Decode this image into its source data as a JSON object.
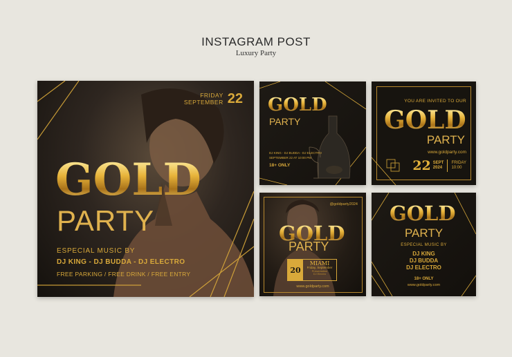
{
  "header": {
    "title": "INSTAGRAM POST",
    "subtitle": "Luxury Party"
  },
  "colors": {
    "background": "#e8e6df",
    "card": "#1a1712",
    "gold": "#d9a93a"
  },
  "main_card": {
    "day": "FRIDAY",
    "month": "SEPTEMBER",
    "date": "22",
    "title": "GOLD",
    "subtitle": "PARTY",
    "music_label": "ESPECIAL MUSIC BY",
    "djs": "DJ KING - DJ BUDDA - DJ ELECTRO",
    "perks": "FREE PARKING / FREE DRINK / FREE ENTRY"
  },
  "card2": {
    "title": "GOLD",
    "subtitle": "PARTY",
    "line1": "DJ KING - DJ BUDDA - DJ ELECTRO",
    "line2": "SEPTEMBER 22 AT 10:00 PM",
    "age": "18+ ONLY"
  },
  "card3": {
    "invite": "YOU ARE INVITED TO OUR",
    "title": "GOLD",
    "subtitle": "PARTY",
    "url": "www.goldparty.com",
    "date": "22",
    "month": "SEPT",
    "year": "2024",
    "day": "FRIDAY",
    "time": "10:00"
  },
  "card4": {
    "handle": "@goldparty2024",
    "title": "GOLD",
    "subtitle": "PARTY",
    "date": "20",
    "city": "MIAMI",
    "when": "Friday, September",
    "note1": "Presentation",
    "note2": "DJ Electro",
    "url": "www.goldparty.com"
  },
  "card5": {
    "title": "GOLD",
    "subtitle": "PARTY",
    "music_label": "ESPECIAL MUSIC BY",
    "dj1": "DJ KING",
    "dj2": "DJ BUDDA",
    "dj3": "DJ ELECTRO",
    "age": "18+ ONLY",
    "url": "www.goldparty.com"
  }
}
